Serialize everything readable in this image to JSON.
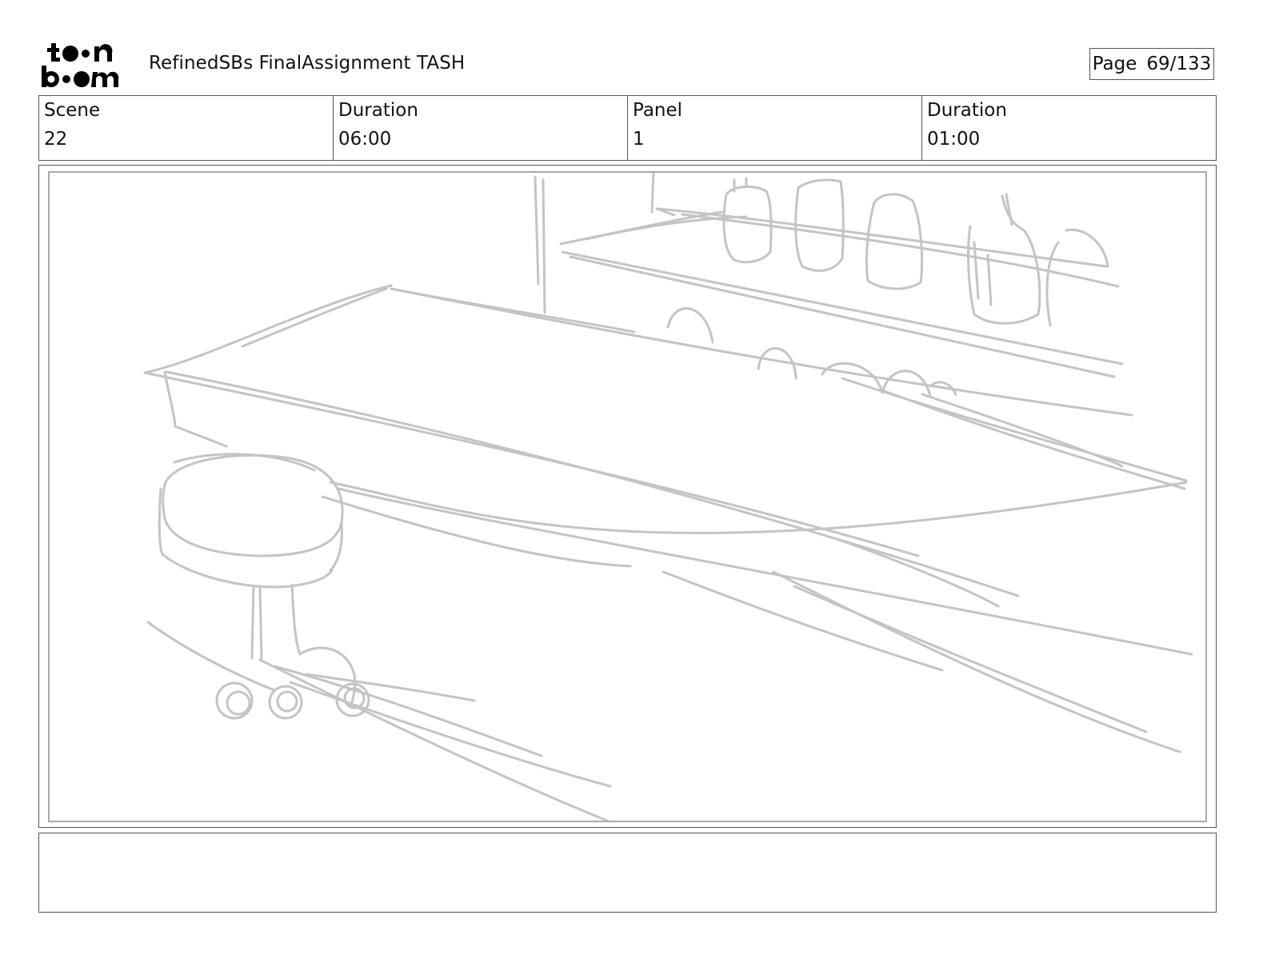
{
  "header": {
    "logo_text": "toon boom",
    "title": "RefinedSBs FinalAssignment TASH",
    "page_label": "Page",
    "page_value": "69/133"
  },
  "info": {
    "scene_label": "Scene",
    "scene_value": "22",
    "scene_duration_label": "Duration",
    "scene_duration_value": "06:00",
    "panel_label": "Panel",
    "panel_value": "1",
    "panel_duration_label": "Duration",
    "panel_duration_value": "01:00"
  },
  "panel": {
    "sketch_stroke_color": "#c4c4c4"
  },
  "notes": {
    "text": ""
  }
}
